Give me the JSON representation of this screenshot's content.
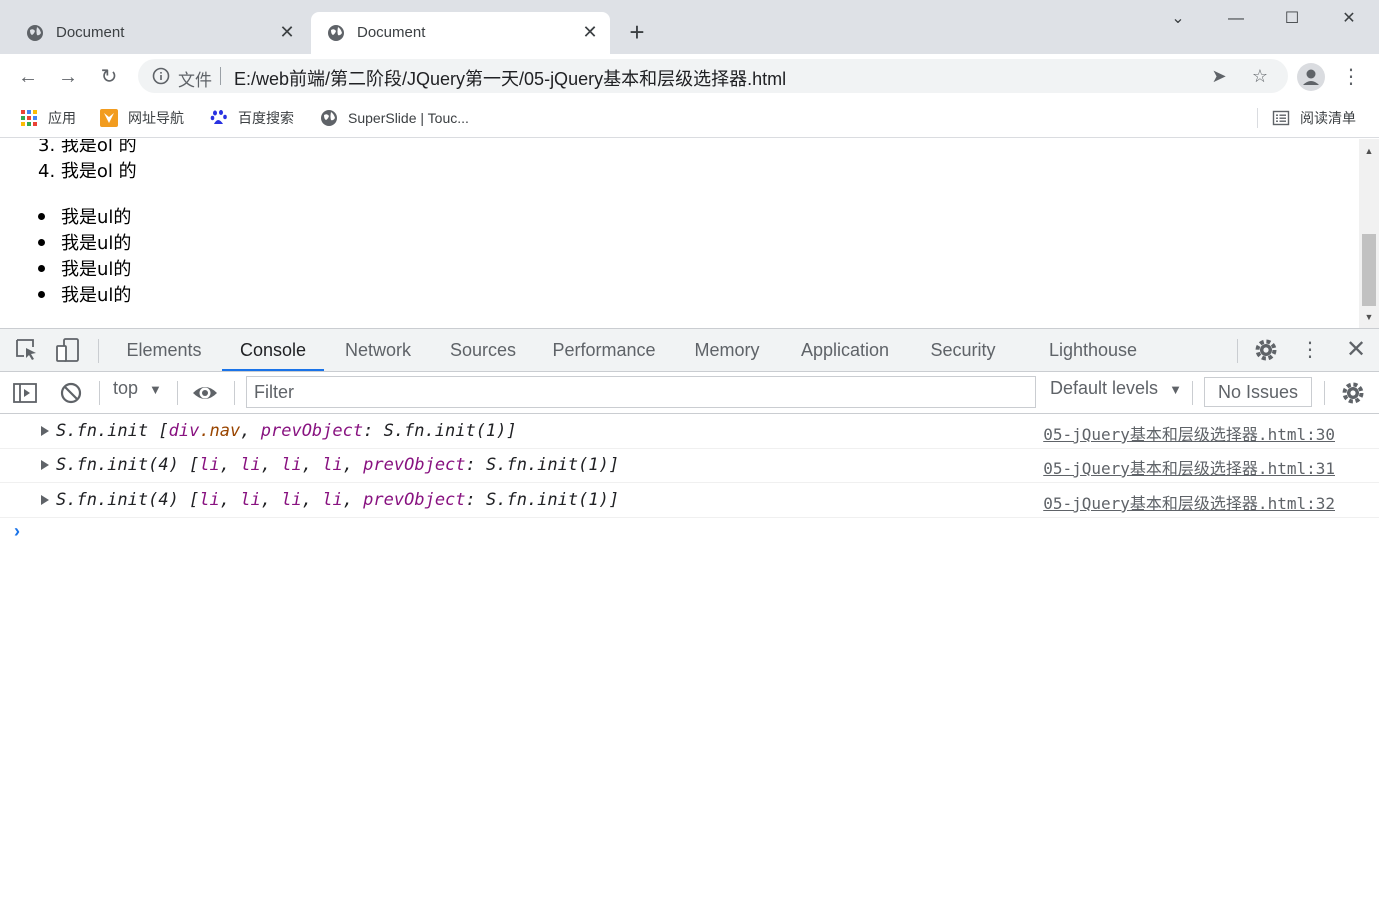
{
  "tabs": [
    {
      "title": "Document",
      "close": "✕"
    },
    {
      "title": "Document",
      "close": "✕"
    }
  ],
  "new_tab": "+",
  "window": {
    "minimize": "—",
    "maximize": "☐",
    "close": "✕",
    "dropdown": "⌄"
  },
  "omnibox": {
    "label": "文件",
    "url": "E:/web前端/第二阶段/JQuery第一天/05-jQuery基本和层级选择器.html"
  },
  "bookmarks": [
    {
      "label": "应用",
      "icon": "apps-grid-icon"
    },
    {
      "label": "网址导航",
      "icon": "nav-arrow-icon"
    },
    {
      "label": "百度搜索",
      "icon": "baidu-paw-icon"
    },
    {
      "label": "SuperSlide | Touc...",
      "icon": "globe-icon"
    }
  ],
  "reading_list": "阅读清单",
  "page": {
    "ol_items": [
      "3. 我是ol 的",
      "4. 我是ol 的"
    ],
    "ul_items": [
      "我是ul的",
      "我是ul的",
      "我是ul的",
      "我是ul的"
    ]
  },
  "devtools": {
    "tabs": [
      "Elements",
      "Console",
      "Network",
      "Sources",
      "Performance",
      "Memory",
      "Application",
      "Security",
      "Lighthouse"
    ],
    "active_tab": "Console",
    "context": "top",
    "filter_placeholder": "Filter",
    "levels": "Default levels",
    "issues": "No Issues",
    "rows": [
      {
        "parts": [
          {
            "t": "S.fn.init [",
            "c": ""
          },
          {
            "t": "div",
            "c": "purple"
          },
          {
            "t": ".nav",
            "c": "brown"
          },
          {
            "t": ", ",
            "c": ""
          },
          {
            "t": "prevObject",
            "c": "purple"
          },
          {
            "t": ": S.fn.init(1)]",
            "c": ""
          }
        ],
        "source": "05-jQuery基本和层级选择器.html:30"
      },
      {
        "parts": [
          {
            "t": "S.fn.init(4) [",
            "c": ""
          },
          {
            "t": "li",
            "c": "purple"
          },
          {
            "t": ", ",
            "c": ""
          },
          {
            "t": "li",
            "c": "purple"
          },
          {
            "t": ", ",
            "c": ""
          },
          {
            "t": "li",
            "c": "purple"
          },
          {
            "t": ", ",
            "c": ""
          },
          {
            "t": "li",
            "c": "purple"
          },
          {
            "t": ", ",
            "c": ""
          },
          {
            "t": "prevObject",
            "c": "purple"
          },
          {
            "t": ": S.fn.init(1)]",
            "c": ""
          }
        ],
        "source": "05-jQuery基本和层级选择器.html:31"
      },
      {
        "parts": [
          {
            "t": "S.fn.init(4) [",
            "c": ""
          },
          {
            "t": "li",
            "c": "purple"
          },
          {
            "t": ", ",
            "c": ""
          },
          {
            "t": "li",
            "c": "purple"
          },
          {
            "t": ", ",
            "c": ""
          },
          {
            "t": "li",
            "c": "purple"
          },
          {
            "t": ", ",
            "c": ""
          },
          {
            "t": "li",
            "c": "purple"
          },
          {
            "t": ", ",
            "c": ""
          },
          {
            "t": "prevObject",
            "c": "purple"
          },
          {
            "t": ": S.fn.init(1)]",
            "c": ""
          }
        ],
        "source": "05-jQuery基本和层级选择器.html:32"
      }
    ],
    "prompt": "›"
  },
  "colors": {
    "accent": "#1a73e8",
    "purple": "#881280",
    "brown": "#994500"
  }
}
